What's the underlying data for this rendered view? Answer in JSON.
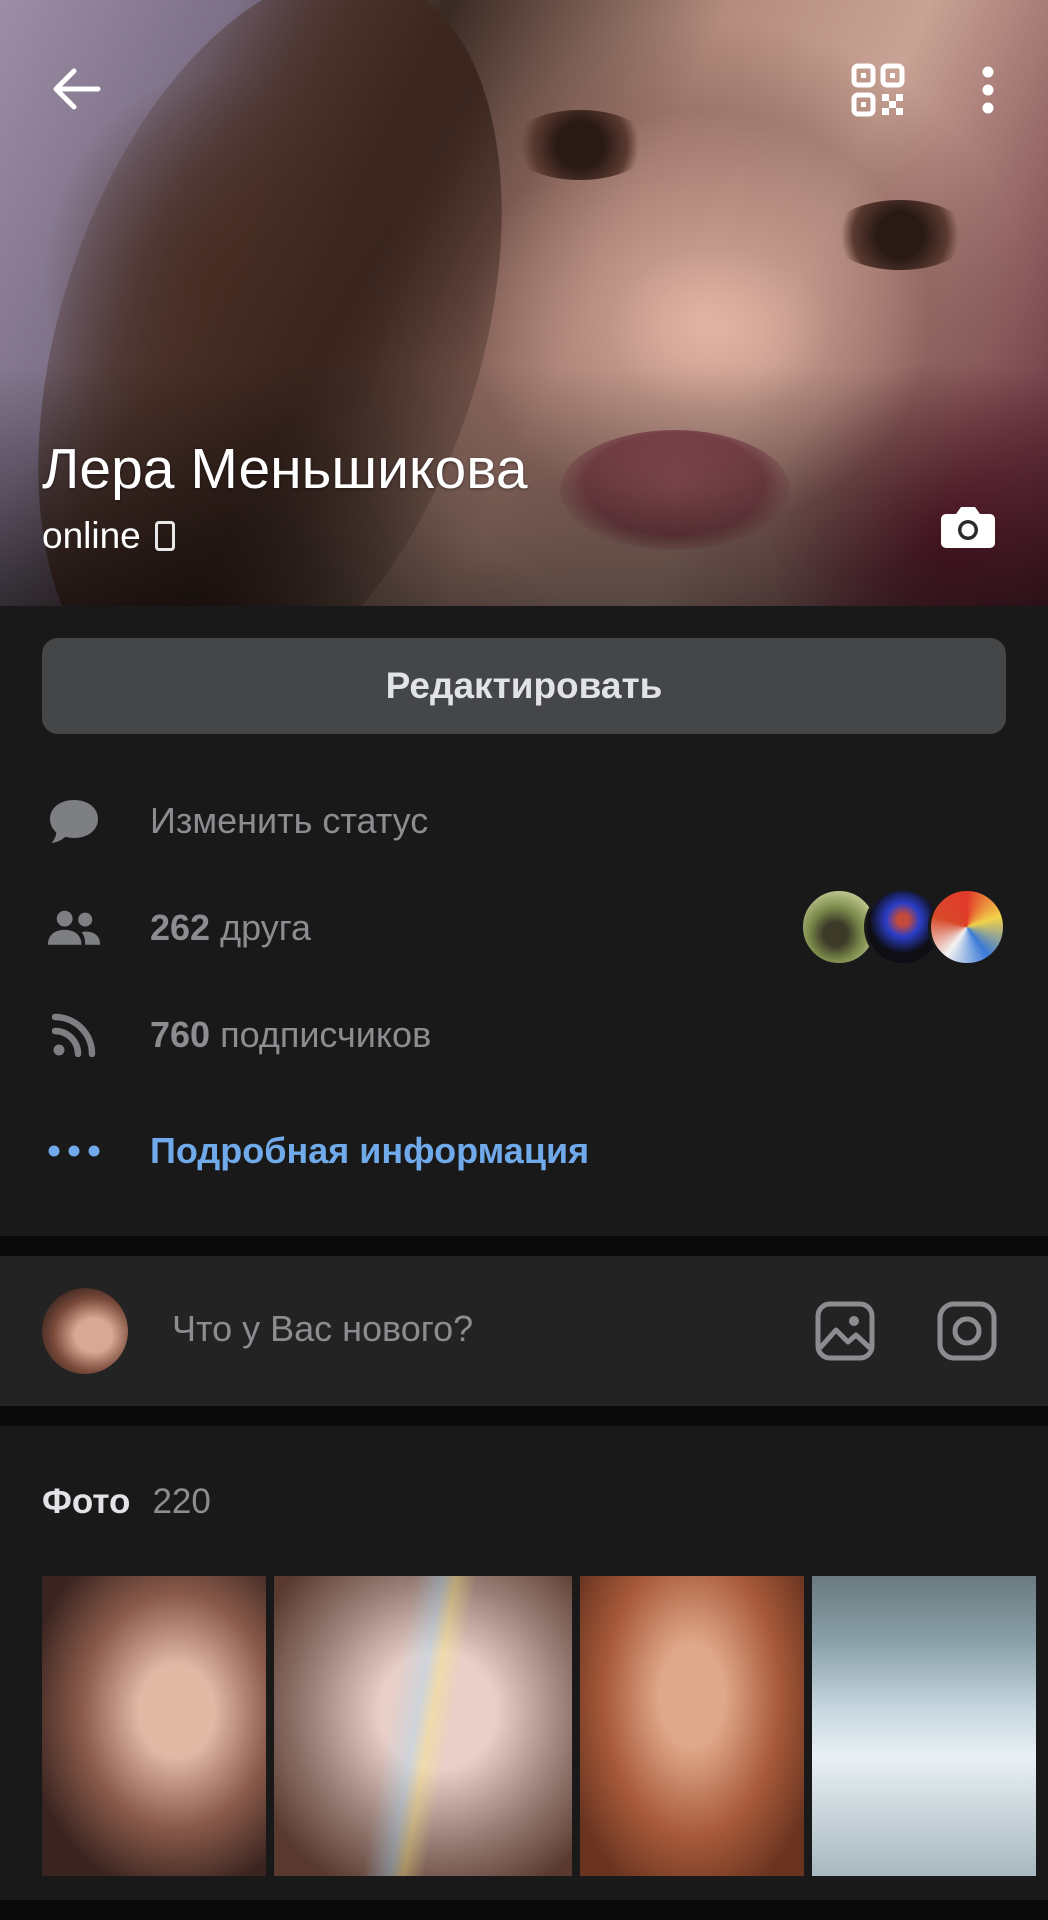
{
  "profile": {
    "name": "Лера Меньшикова",
    "online": "online"
  },
  "actions": {
    "edit_label": "Редактировать"
  },
  "info_rows": {
    "status": "Изменить статус",
    "friends_count": "262",
    "friends_word": "друга",
    "followers_count": "760",
    "followers_word": "подписчиков",
    "details": "Подробная информация"
  },
  "composer": {
    "placeholder": "Что у Вас нового?"
  },
  "photos": {
    "label": "Фото",
    "count": "220"
  },
  "colors": {
    "background": "#19191a",
    "accent_link": "#71aaeb",
    "button_bg": "#454647",
    "secondary_text": "#8b8d90"
  },
  "icons": {
    "back": "arrow-left-icon",
    "qr": "qr-code-icon",
    "more": "more-vertical-icon",
    "camera": "camera-icon",
    "status": "message-bubble-icon",
    "friends": "users-icon",
    "followers": "rss-icon",
    "details": "more-horizontal-icon",
    "image": "image-icon",
    "instagram": "instagram-icon"
  }
}
